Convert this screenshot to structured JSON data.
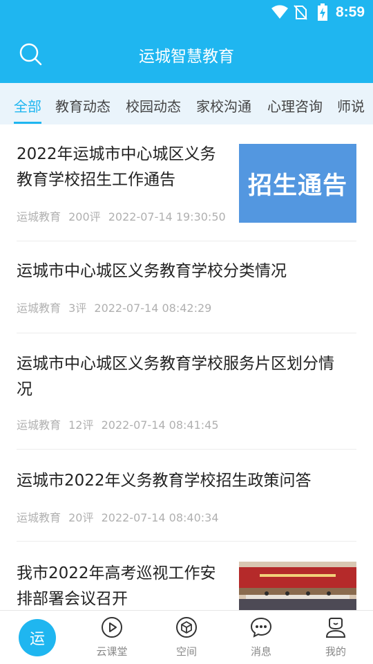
{
  "status_bar": {
    "time": "8:59"
  },
  "header": {
    "title": "运城智慧教育"
  },
  "tabs": [
    {
      "label": "全部"
    },
    {
      "label": "教育动态"
    },
    {
      "label": "校园动态"
    },
    {
      "label": "家校沟通"
    },
    {
      "label": "心理咨询"
    },
    {
      "label": "师说"
    }
  ],
  "articles": [
    {
      "title_line1": "2022年运城市中心城区义务",
      "title_line2": "教育学校招生工作通告",
      "source": "运城教育",
      "comments": "200评",
      "time": "2022-07-14 19:30:50",
      "thumb_text": "招生通告"
    },
    {
      "title_line1": "运城市中心城区义务教育学校分类情况",
      "source": "运城教育",
      "comments": "3评",
      "time": "2022-07-14 08:42:29"
    },
    {
      "title_line1": "运城市中心城区义务教育学校服务片区划分情",
      "title_line2": "况",
      "source": "运城教育",
      "comments": "12评",
      "time": "2022-07-14 08:41:45"
    },
    {
      "title_line1": "运城市2022年义务教育学校招生政策问答",
      "source": "运城教育",
      "comments": "20评",
      "time": "2022-07-14 08:40:34"
    },
    {
      "title_line1": "我市2022年高考巡视工作安",
      "title_line2": "排部署会议召开"
    }
  ],
  "bottom_nav": {
    "home": "运",
    "items": [
      {
        "label": "云课堂",
        "icon": "play-circle-icon"
      },
      {
        "label": "空间",
        "icon": "cube-icon"
      },
      {
        "label": "消息",
        "icon": "chat-bubble-icon"
      },
      {
        "label": "我的",
        "icon": "user-icon"
      }
    ]
  },
  "colors": {
    "accent": "#1fb6f0",
    "tab_bg": "#eaf4fb",
    "thumb_blue": "#5397e0"
  }
}
